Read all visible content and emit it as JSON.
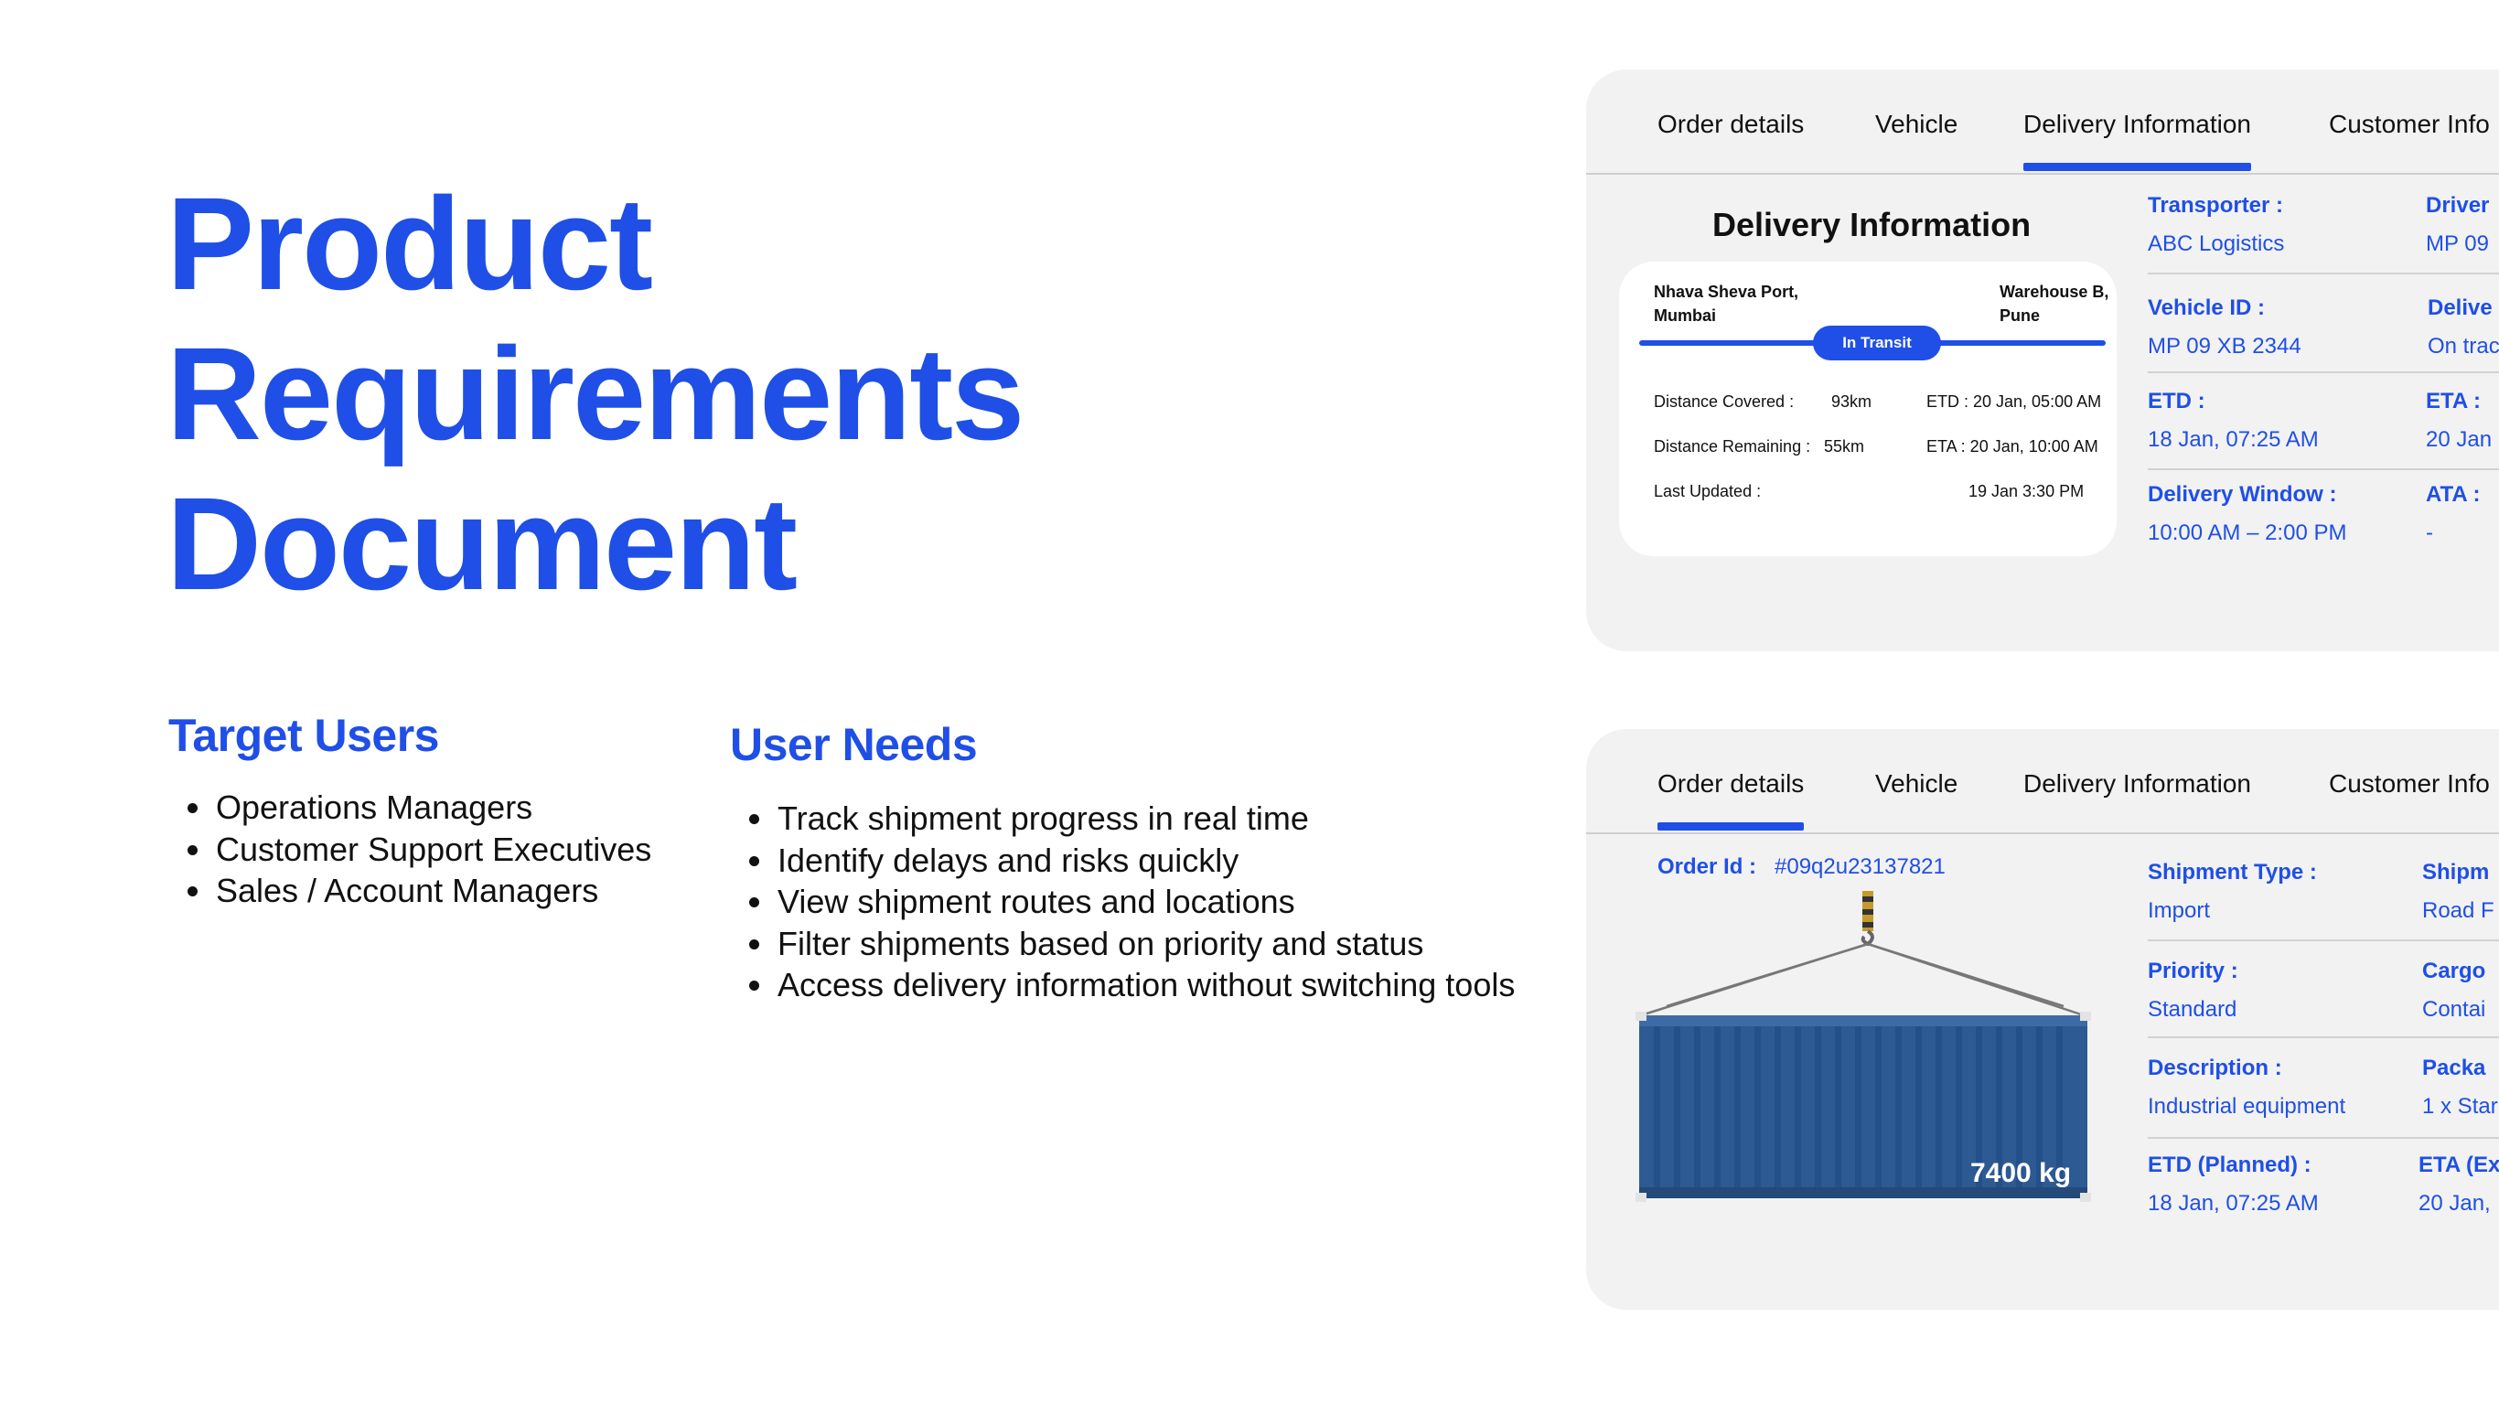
{
  "title": {
    "line1": "Product",
    "line2": "Requirements",
    "line3": "Document"
  },
  "target_users": {
    "heading": "Target Users",
    "items": [
      "Operations Managers",
      "Customer Support Executives",
      "Sales / Account Managers"
    ]
  },
  "user_needs": {
    "heading": "User Needs",
    "items": [
      "Track shipment progress in real time",
      "Identify delays and risks quickly",
      "View shipment routes and locations",
      "Filter shipments based on priority and status",
      "Access delivery information without switching tools"
    ]
  },
  "tabs": [
    "Order details",
    "Vehicle",
    "Delivery Information",
    "Customer Info"
  ],
  "delivery_card": {
    "active_tab": "Delivery Information",
    "title": "Delivery Information",
    "route": {
      "origin_line1": "Nhava Sheva Port,",
      "origin_line2": "Mumbai",
      "destination_line1": "Warehouse B,",
      "destination_line2": "Pune",
      "status": "In Transit"
    },
    "stats": {
      "distance_covered_label": "Distance Covered :",
      "distance_covered_value": "93km",
      "etd": "ETD : 20 Jan, 05:00 AM",
      "distance_remaining_label": "Distance Remaining :",
      "distance_remaining_value": "55km",
      "eta": "ETA : 20 Jan, 10:00 AM",
      "last_updated_label": "Last Updated :",
      "last_updated_value": "19 Jan 3:30 PM"
    },
    "fields_left": [
      {
        "label": "Transporter :",
        "value": "ABC Logistics"
      },
      {
        "label": "Vehicle ID :",
        "value": "MP 09 XB 2344"
      },
      {
        "label": "ETD :",
        "value": "18 Jan, 07:25 AM"
      },
      {
        "label": "Delivery Window :",
        "value": "10:00 AM – 2:00 PM"
      }
    ],
    "fields_right": [
      {
        "label": "Driver",
        "value": "MP 09"
      },
      {
        "label": "Delive",
        "value": "On trac"
      },
      {
        "label": "ETA :",
        "value": "20 Jan"
      },
      {
        "label": "ATA :",
        "value": "-"
      }
    ]
  },
  "order_card": {
    "active_tab": "Order details",
    "order_id_label": "Order Id :",
    "order_id_value": "#09q2u23137821",
    "weight": "7400 kg",
    "fields_left": [
      {
        "label": "Shipment Type :",
        "value": "Import"
      },
      {
        "label": "Priority :",
        "value": "Standard"
      },
      {
        "label": "Description :",
        "value": "Industrial equipment"
      },
      {
        "label": "ETD (Planned) :",
        "value": "18 Jan, 07:25 AM"
      }
    ],
    "fields_right": [
      {
        "label": "Shipm",
        "value": "Road F"
      },
      {
        "label": "Cargo",
        "value": "Contai"
      },
      {
        "label": "Packa",
        "value": "1 x Star"
      },
      {
        "label": "ETA (Ex",
        "value": "20 Jan,"
      }
    ]
  },
  "colors": {
    "accent": "#1f4fe6",
    "card_bg": "#f2f2f2",
    "container": "#2d5a92"
  },
  "icons": [
    "container-image",
    "crane-hook-icon"
  ]
}
